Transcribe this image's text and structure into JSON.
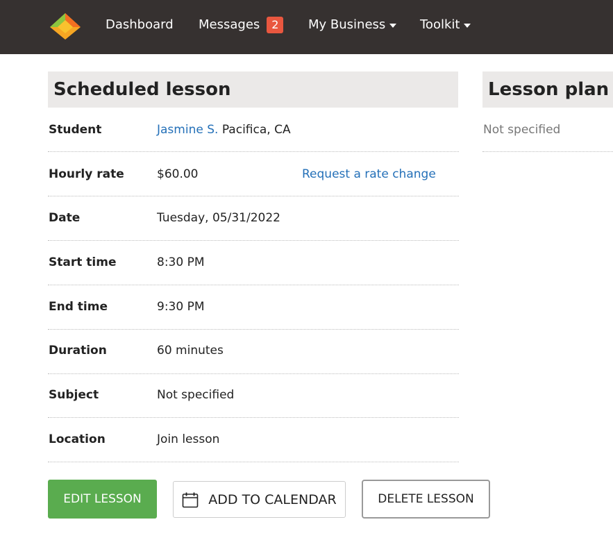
{
  "nav": {
    "dashboard": "Dashboard",
    "messages": "Messages",
    "messages_count": "2",
    "my_business": "My Business",
    "toolkit": "Toolkit"
  },
  "scheduled": {
    "title": "Scheduled lesson",
    "rows": [
      {
        "label": "Student",
        "value_link": "Jasmine S.",
        "value_text": "Pacifica, CA"
      },
      {
        "label": "Hourly rate",
        "value": "$60.00",
        "action": "Request a rate change"
      },
      {
        "label": "Date",
        "value": "Tuesday, 05/31/2022"
      },
      {
        "label": "Start time",
        "value": "8:30 PM"
      },
      {
        "label": "End time",
        "value": "9:30 PM"
      },
      {
        "label": "Duration",
        "value": "60 minutes"
      },
      {
        "label": "Subject",
        "value": "Not specified"
      },
      {
        "label": "Location",
        "value": "Join lesson"
      }
    ]
  },
  "plan": {
    "title": "Lesson plan",
    "value": "Not specified"
  },
  "buttons": {
    "edit": "EDIT LESSON",
    "calendar": "ADD TO CALENDAR",
    "delete": "DELETE LESSON"
  },
  "colors": {
    "navbar": "#363130",
    "badge": "#e9573f",
    "link": "#2470b8",
    "edit_button": "#5aac4f",
    "panel_header": "#ebe9e8"
  },
  "icons": {
    "logo": "brand-logo-icon",
    "caret": "caret-down-icon",
    "calendar": "calendar-icon"
  }
}
